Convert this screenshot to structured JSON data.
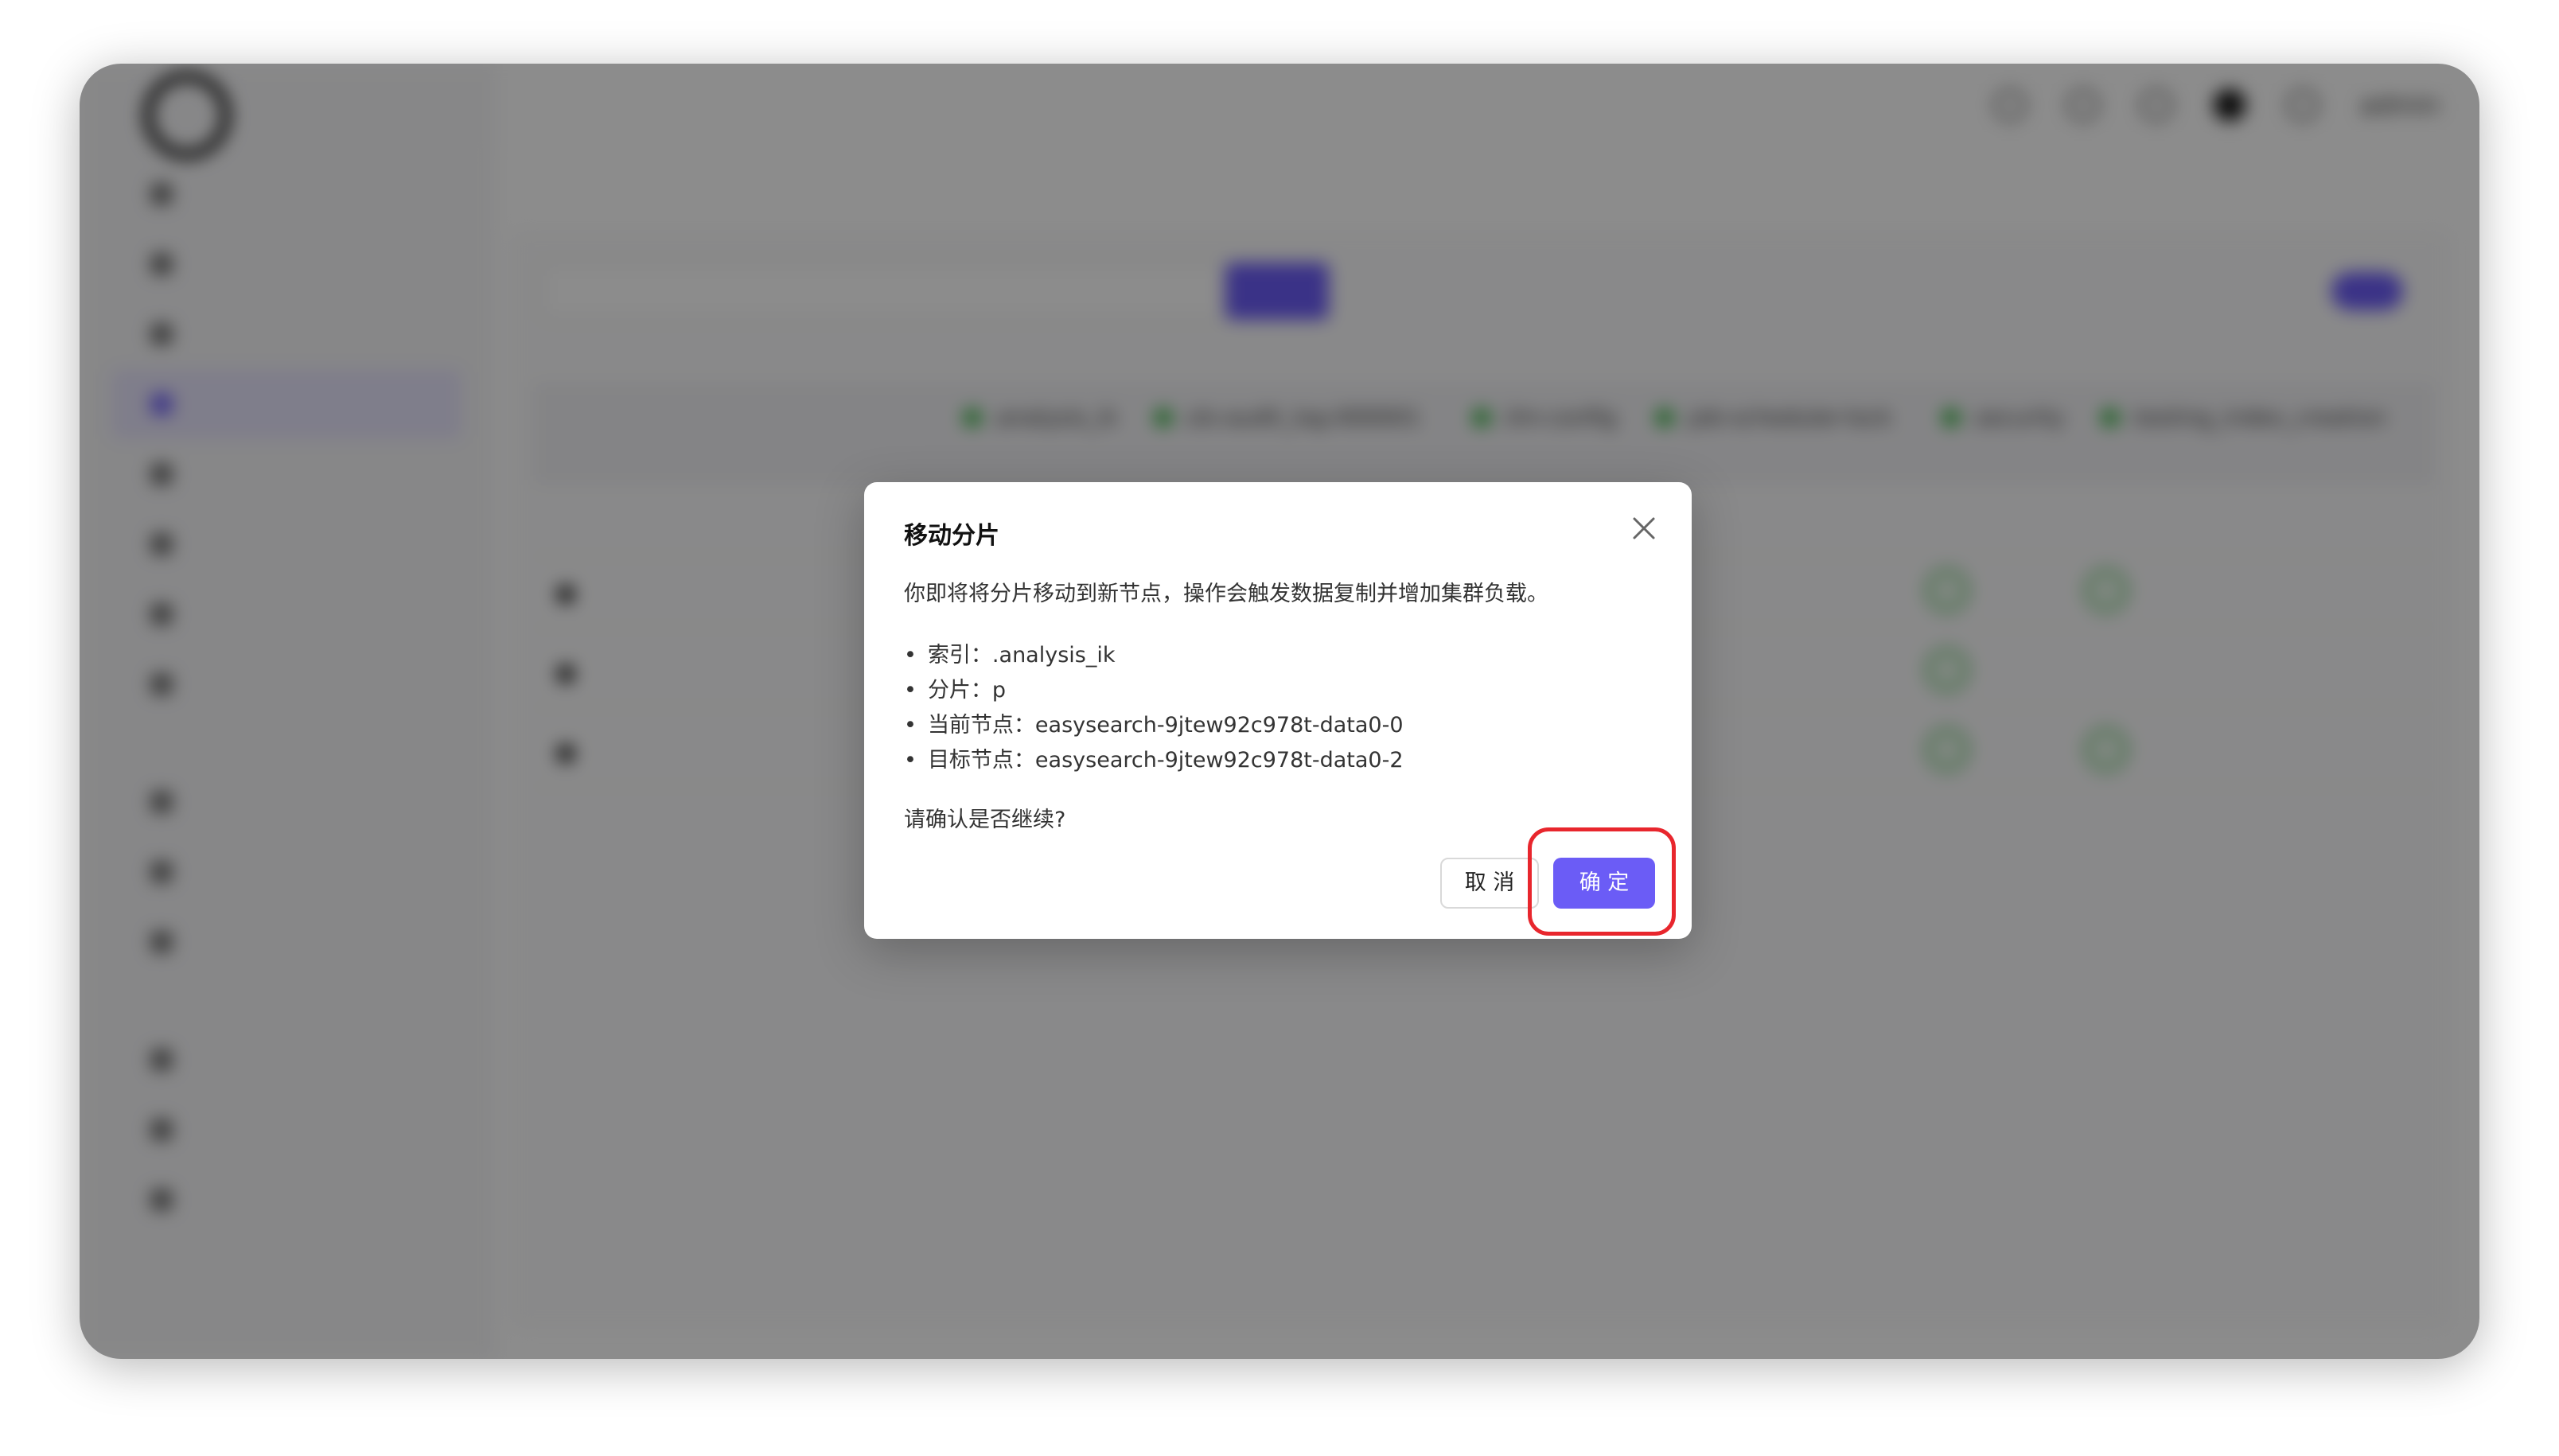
{
  "modal": {
    "title": "移动分片",
    "description": "你即将将分片移动到新节点，操作会触发数据复制并增加集群负载。",
    "details": [
      "索引：.analysis_ik",
      "分片：p",
      "当前节点：easysearch-9jtew92c978t-data0-0",
      "目标节点：easysearch-9jtew92c978t-data0-2"
    ],
    "confirm_question": "请确认是否继续?",
    "cancel_label": "取 消",
    "ok_label": "确 定"
  },
  "background": {
    "columns": [
      ".analysis_ik",
      ".sls-audit_log-000001",
      ".ilm-config",
      ".job-scheduler-lock",
      ".security",
      ".testing_index_creation"
    ],
    "user": "admin"
  },
  "colors": {
    "accent": "#6b5cf6",
    "highlight": "#e8262d",
    "healthy": "#3bb346"
  },
  "icons": {
    "close": "close-icon"
  }
}
